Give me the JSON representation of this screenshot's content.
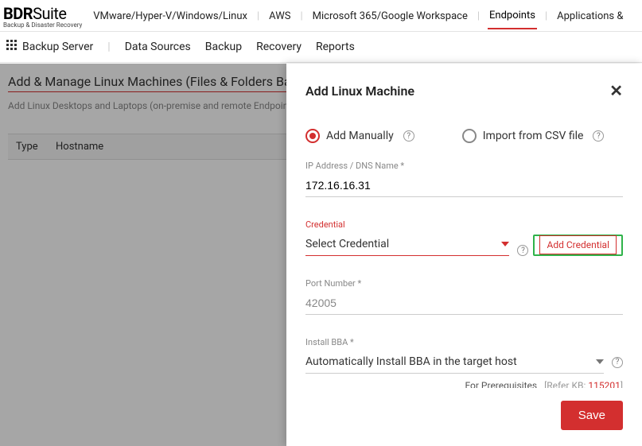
{
  "brand": {
    "name_bold": "BDR",
    "name_rest": "Suite",
    "sub": "Backup & Disaster Recovery"
  },
  "topnav": {
    "items": [
      "VMware/Hyper-V/Windows/Linux",
      "AWS",
      "Microsoft 365/Google Workspace",
      "Endpoints",
      "Applications &"
    ],
    "active_index": 3
  },
  "subnav": {
    "lead": "Backup Server",
    "items": [
      "Data Sources",
      "Backup",
      "Recovery",
      "Reports"
    ]
  },
  "page": {
    "title": "Add & Manage Linux Machines (Files & Folders Backup)",
    "subtitle": "Add Linux Desktops and Laptops (on-premise and remote Endpoint",
    "columns": {
      "type": "Type",
      "hostname": "Hostname"
    }
  },
  "panel": {
    "title": "Add Linux Machine",
    "radio": {
      "manual": "Add Manually",
      "csv": "Import from CSV file",
      "selected": "manual"
    },
    "ip": {
      "label": "IP Address / DNS Name *",
      "value": "172.16.16.31"
    },
    "credential": {
      "label": "Credential",
      "selected": "Select Credential",
      "add_link": "Add Credential"
    },
    "port": {
      "label": "Port Number *",
      "value": "42005"
    },
    "install": {
      "label": "Install BBA *",
      "selected": "Automatically Install BBA in the target host"
    },
    "prereq": {
      "text": "For Prerequisites",
      "kb_label": "[Refer KB:",
      "kb_num": "115201",
      "kb_close": "]"
    },
    "save": "Save"
  }
}
